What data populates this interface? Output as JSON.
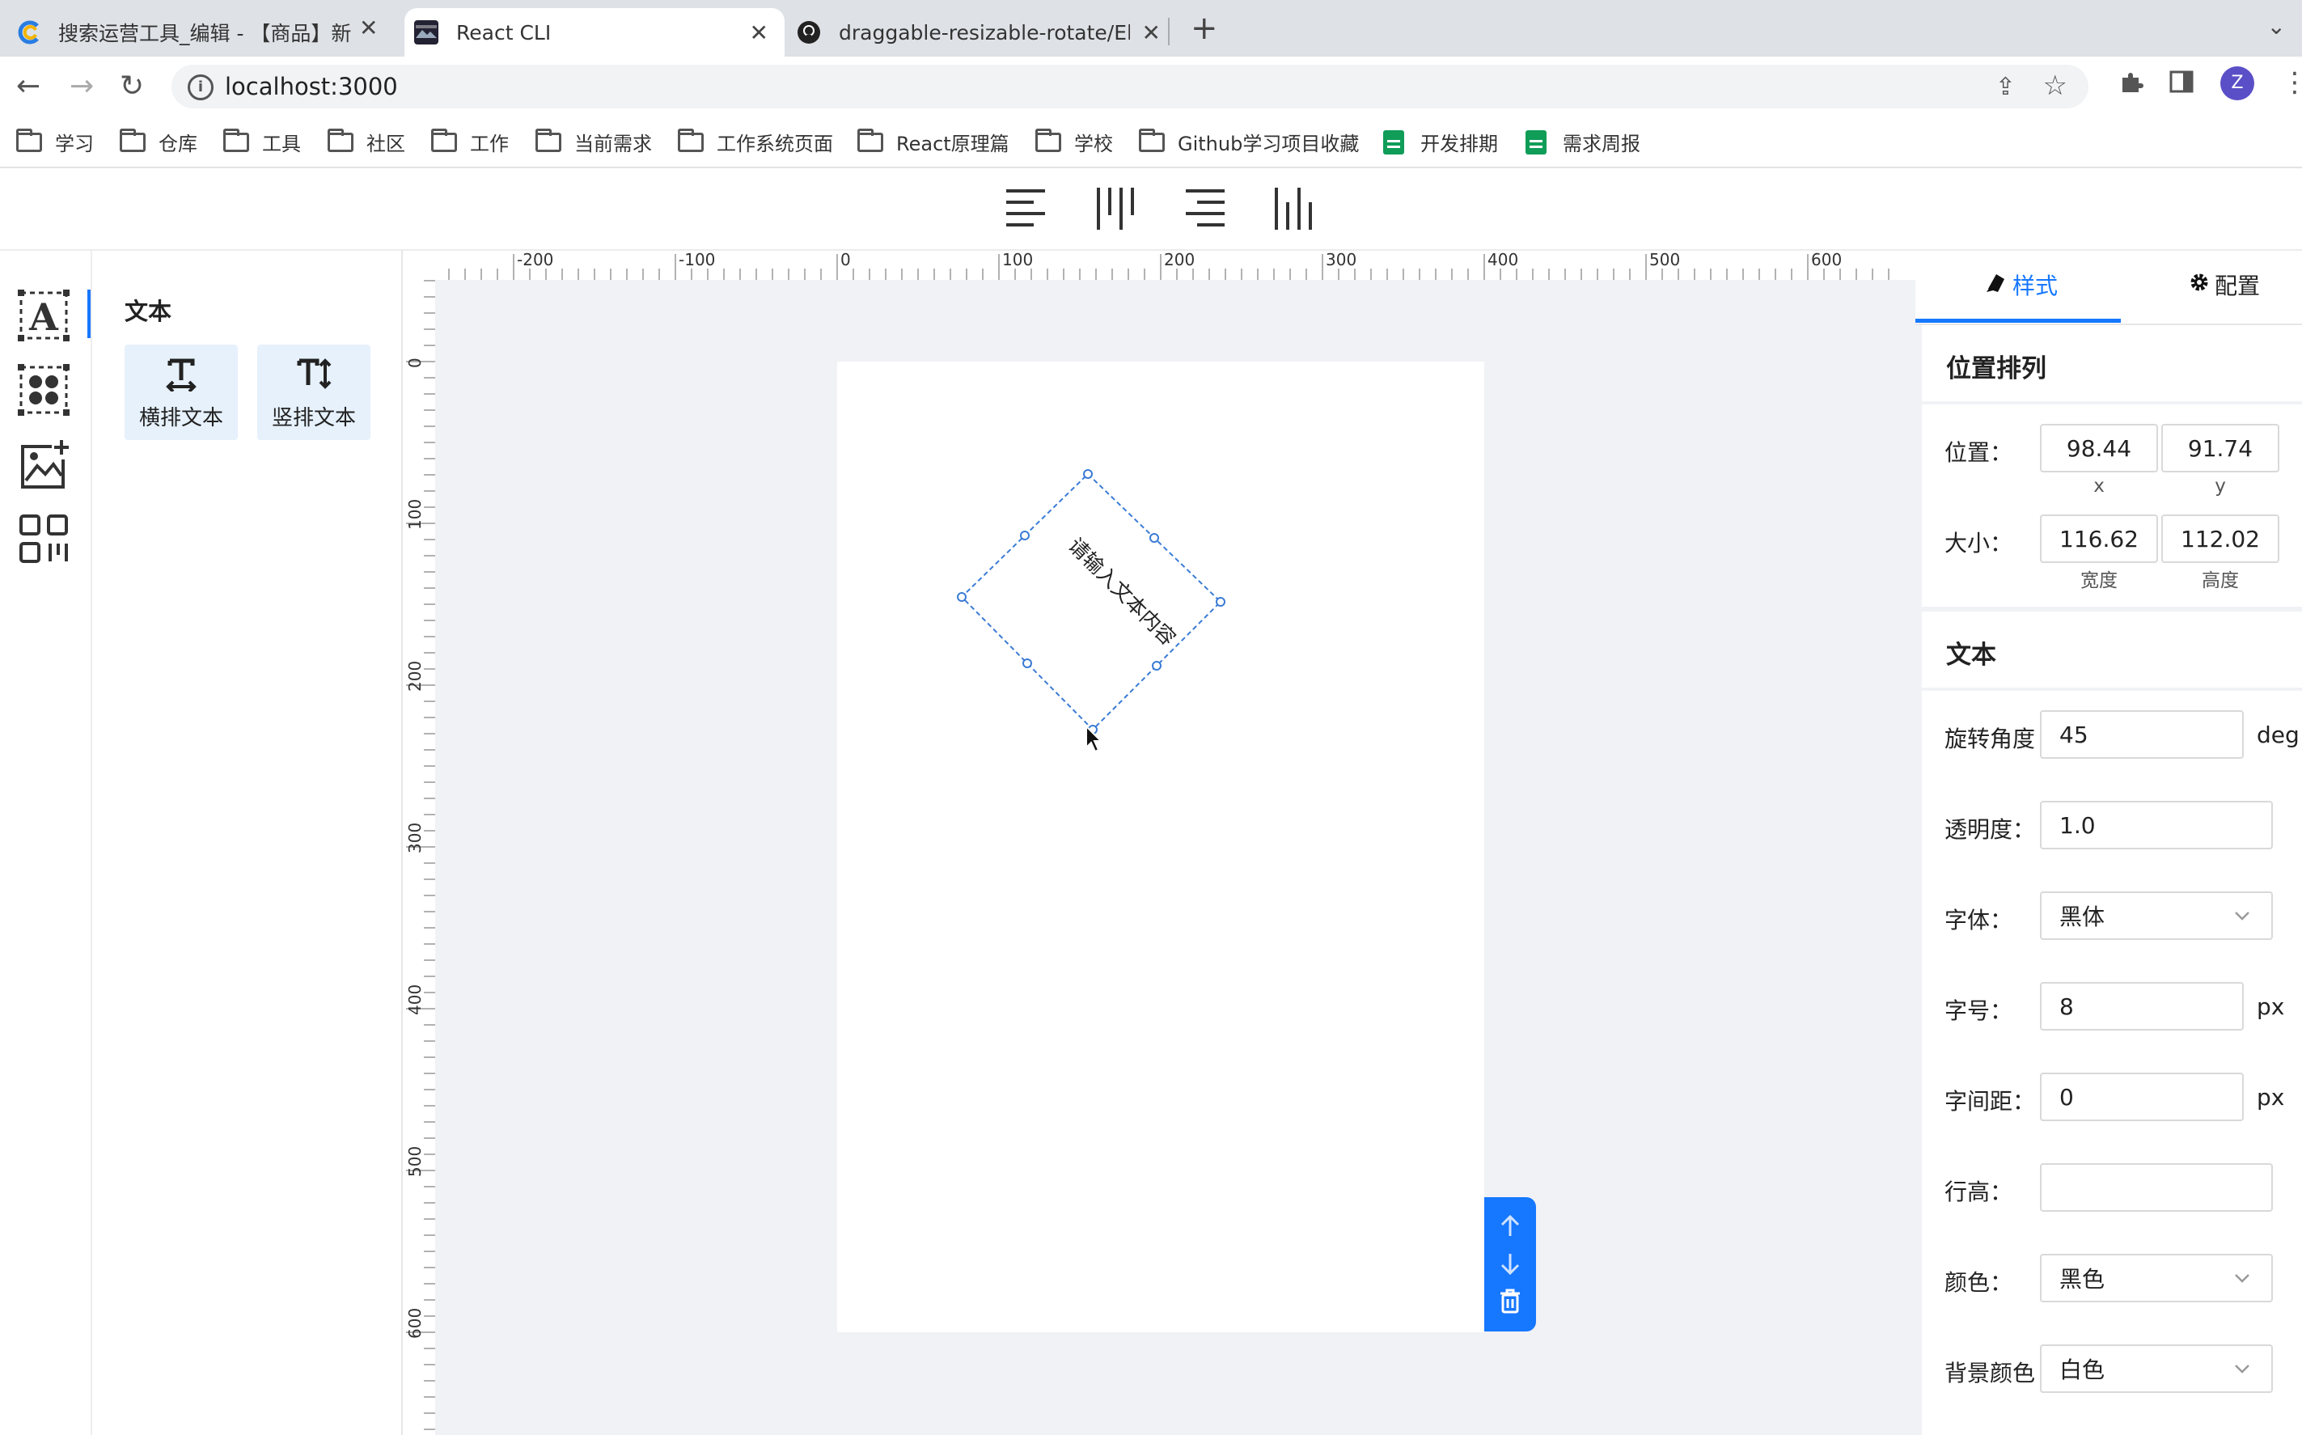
{
  "browser": {
    "tabs": [
      {
        "title": "搜索运营工具_编辑 - 【商品】新",
        "active": false
      },
      {
        "title": "React CLI",
        "active": true
      },
      {
        "title": "draggable-resizable-rotate/Ele",
        "active": false
      }
    ],
    "url": "localhost:3000",
    "profile_initial": "Z",
    "bookmarks": [
      {
        "label": "学习",
        "icon": "folder-icon"
      },
      {
        "label": "仓库",
        "icon": "folder-icon"
      },
      {
        "label": "工具",
        "icon": "folder-icon"
      },
      {
        "label": "社区",
        "icon": "folder-icon"
      },
      {
        "label": "工作",
        "icon": "folder-icon"
      },
      {
        "label": "当前需求",
        "icon": "folder-icon"
      },
      {
        "label": "工作系统页面",
        "icon": "folder-icon"
      },
      {
        "label": "React原理篇",
        "icon": "folder-icon"
      },
      {
        "label": "学校",
        "icon": "folder-icon"
      },
      {
        "label": "Github学习项目收藏",
        "icon": "folder-icon"
      },
      {
        "label": "开发排期",
        "icon": "sheets-icon"
      },
      {
        "label": "需求周报",
        "icon": "sheets-icon"
      }
    ]
  },
  "toolbar": {
    "buttons": [
      "align-left-icon",
      "align-vertical-top-icon",
      "align-right-icon",
      "align-vertical-bottom-icon"
    ]
  },
  "left_rail": {
    "items": [
      "text-tool-icon",
      "shapes-tool-icon",
      "image-tool-icon",
      "qrcode-tool-icon"
    ],
    "active": "text-tool-icon"
  },
  "left_panel": {
    "title": "文本",
    "cards": [
      {
        "label": "横排文本",
        "glyph": "T",
        "icon": "horizontal-text-icon"
      },
      {
        "label": "竖排文本",
        "glyph": "T↕",
        "icon": "vertical-text-icon"
      }
    ]
  },
  "rulers": {
    "horizontal_labels": [
      "-200",
      "-100",
      "0",
      "100",
      "200",
      "300",
      "400",
      "500",
      "600"
    ],
    "vertical_labels": [
      "0",
      "100",
      "200",
      "300",
      "400",
      "500",
      "600"
    ]
  },
  "canvas": {
    "element_text": "请输入文本内容",
    "rotation_deg": 45
  },
  "right_panel": {
    "tabs": [
      {
        "label": "样式",
        "icon": "brush-icon",
        "active": true
      },
      {
        "label": "配置",
        "icon": "gear-icon",
        "active": false
      }
    ],
    "position_section": {
      "title": "位置排列",
      "position_label": "位置：",
      "x_value": "98.44",
      "y_value": "91.74",
      "x_caption": "x",
      "y_caption": "y",
      "size_label": "大小：",
      "width_value": "116.62",
      "height_value": "112.02",
      "width_caption": "宽度",
      "height_caption": "高度"
    },
    "text_section": {
      "title": "文本",
      "rotation_label": "旋转角度",
      "rotation_value": "45",
      "rotation_unit": "deg",
      "opacity_label": "透明度：",
      "opacity_value": "1.0",
      "font_label": "字体：",
      "font_value": "黑体",
      "font_size_label": "字号：",
      "font_size_value": "8",
      "font_size_unit": "px",
      "letter_spacing_label": "字间距：",
      "letter_spacing_value": "0",
      "letter_spacing_unit": "px",
      "line_height_label": "行高：",
      "line_height_value": "",
      "color_label": "颜色：",
      "color_value": "黑色",
      "bg_color_label": "背景颜色",
      "bg_color_value": "白色"
    }
  },
  "colors": {
    "accent": "#1677ff",
    "selection": "#3a7bd5"
  }
}
